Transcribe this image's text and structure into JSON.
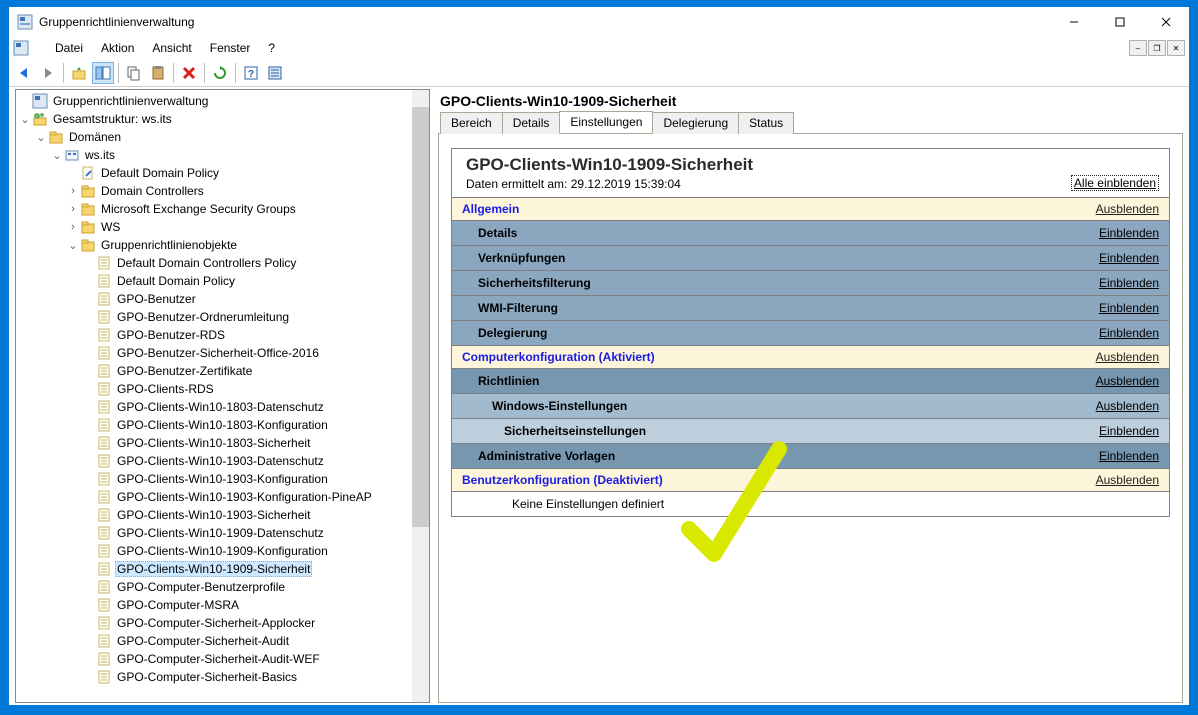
{
  "window": {
    "title": "Gruppenrichtlinienverwaltung"
  },
  "menubar": {
    "items": [
      "Datei",
      "Aktion",
      "Ansicht",
      "Fenster",
      "?"
    ]
  },
  "tree": {
    "root": "Gruppenrichtlinienverwaltung",
    "forest": "Gesamtstruktur: ws.its",
    "domains": "Domänen",
    "domain": "ws.its",
    "default_domain_policy": "Default Domain Policy",
    "domain_controllers": "Domain Controllers",
    "mesg": "Microsoft Exchange Security Groups",
    "ws": "WS",
    "gpo_container": "Gruppenrichtlinienobjekte",
    "gpos": [
      "Default Domain Controllers Policy",
      "Default Domain Policy",
      "GPO-Benutzer",
      "GPO-Benutzer-Ordnerumleitung",
      "GPO-Benutzer-RDS",
      "GPO-Benutzer-Sicherheit-Office-2016",
      "GPO-Benutzer-Zertifikate",
      "GPO-Clients-RDS",
      "GPO-Clients-Win10-1803-Datenschutz",
      "GPO-Clients-Win10-1803-Konfiguration",
      "GPO-Clients-Win10-1803-Sicherheit",
      "GPO-Clients-Win10-1903-Datenschutz",
      "GPO-Clients-Win10-1903-Konfiguration",
      "GPO-Clients-Win10-1903-Konfiguration-PineAP",
      "GPO-Clients-Win10-1903-Sicherheit",
      "GPO-Clients-Win10-1909-Datenschutz",
      "GPO-Clients-Win10-1909-Konfiguration",
      "GPO-Clients-Win10-1909-Sicherheit",
      "GPO-Computer-Benutzerprofile",
      "GPO-Computer-MSRA",
      "GPO-Computer-Sicherheit-Applocker",
      "GPO-Computer-Sicherheit-Audit",
      "GPO-Computer-Sicherheit-Audit-WEF",
      "GPO-Computer-Sicherheit-Basics"
    ],
    "selected_index": 17
  },
  "details": {
    "title": "GPO-Clients-Win10-1909-Sicherheit",
    "tabs": [
      "Bereich",
      "Details",
      "Einstellungen",
      "Delegierung",
      "Status"
    ],
    "active_tab": 2
  },
  "report": {
    "name": "GPO-Clients-Win10-1909-Sicherheit",
    "timestamp_label": "Daten ermittelt am:",
    "timestamp": "29.12.2019 15:39:04",
    "alle_einblenden": "Alle einblenden",
    "ausblenden": "Ausblenden",
    "einblenden": "Einblenden",
    "sections": {
      "allgemein": "Allgemein",
      "details": "Details",
      "verknuepfungen": "Verknüpfungen",
      "sicherheitsfilterung": "Sicherheitsfilterung",
      "wmi": "WMI-Filterung",
      "delegierung": "Delegierung",
      "computerkonfig": "Computerkonfiguration (Aktiviert)",
      "richtlinien": "Richtlinien",
      "windows_einst": "Windows-Einstellungen",
      "sicherheitseinst": "Sicherheitseinstellungen",
      "admin_vorlagen": "Administrative Vorlagen",
      "benutzerkonfig": "Benutzerkonfiguration (Deaktiviert)",
      "keine": "Keine Einstellungen definiert"
    }
  }
}
